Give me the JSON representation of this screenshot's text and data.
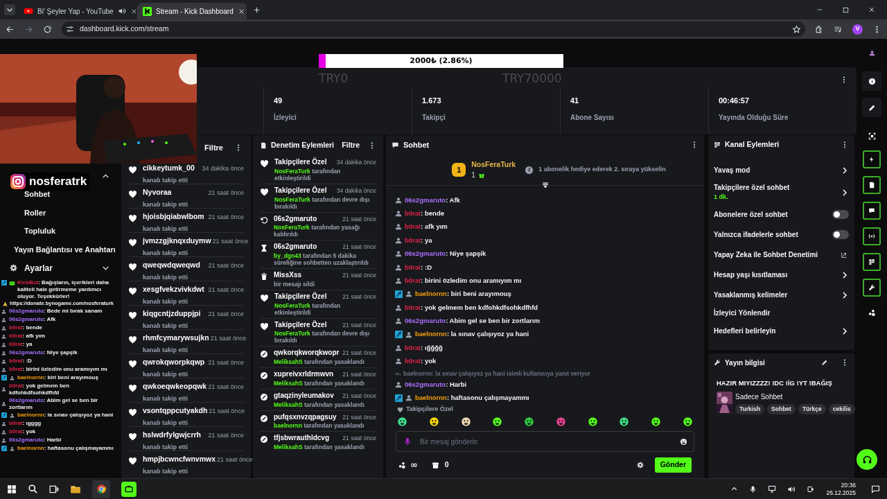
{
  "browser": {
    "tabs": [
      {
        "title": "Bi' Şeyler Yap - YouTube",
        "kind": "youtube",
        "selected": false,
        "audio": true
      },
      {
        "title": "Stream - Kick Dashboard",
        "kind": "kick",
        "selected": true,
        "audio": false
      }
    ],
    "url": "dashboard.kick.com/stream",
    "profile": "V"
  },
  "stream_overlay": {
    "instagram": "nosferatrk",
    "goal": {
      "label": "2000₺ (2.86%)",
      "level": 0.0286,
      "start": "TRY0",
      "end": "TRY70000"
    },
    "chat": [
      {
        "kind": "bot",
        "user": "KickBot",
        "color": "#e0204a",
        "text": ": Bağışların, içerikleri daha kaliteli hale getirmeme yardımcı oluyor. Teşekkürler!",
        "link": "https://donate.bynogame.com/nosferaturk",
        "moderator": true
      },
      {
        "kind": "message",
        "user": "06s2gmaruto",
        "color": "#a970ff",
        "text": ": Bede mi bırak sanam",
        "moderator": false
      },
      {
        "kind": "message",
        "user": "06s2gmaruto",
        "color": "#a970ff",
        "text": ": Afk",
        "moderator": false
      },
      {
        "kind": "message",
        "user": "b0rat",
        "color": "#e0204a",
        "text": ": bende",
        "moderator": false
      },
      {
        "kind": "message",
        "user": "b0rat",
        "color": "#e0204a",
        "text": ": afk yım",
        "moderator": false
      },
      {
        "kind": "message",
        "user": "b0rat",
        "color": "#e0204a",
        "text": ": ya",
        "moderator": false
      },
      {
        "kind": "message",
        "user": "06s2gmaruto",
        "color": "#a970ff",
        "text": ": Niye şapşik",
        "moderator": false
      },
      {
        "kind": "message",
        "user": "b0rat",
        "color": "#e0204a",
        "text": ": :D",
        "moderator": false
      },
      {
        "kind": "message",
        "user": "b0rat",
        "color": "#e0204a",
        "text": ": birini özledim onu aramıyım mı",
        "moderator": false
      },
      {
        "kind": "message",
        "user": "baelnornn",
        "color": "#f59e0b",
        "text": ": biri beni arayımouş",
        "moderator": true
      },
      {
        "kind": "message",
        "user": "b0rat",
        "color": "#e0204a",
        "text": ": yok gelmem ben kdfohkdfsohkdfhfd",
        "moderator": false
      },
      {
        "kind": "message",
        "user": "06s2gmaruto",
        "color": "#a970ff",
        "text": ": Abim gel se ben bir zortlarım",
        "moderator": false
      },
      {
        "kind": "message",
        "user": "baelnornn",
        "color": "#f59e0b",
        "text": ": la sınav çalışıyoz ya hani",
        "moderator": true
      },
      {
        "kind": "message",
        "user": "b0rat",
        "color": "#e0204a",
        "text": ": ıgggg",
        "moderator": false
      },
      {
        "kind": "message",
        "user": "b0rat",
        "color": "#e0204a",
        "text": ": yok",
        "moderator": false
      },
      {
        "kind": "message",
        "user": "06s2gmaruto",
        "color": "#a970ff",
        "text": ": Harbi",
        "moderator": false
      },
      {
        "kind": "message",
        "user": "baelnornn",
        "color": "#f59e0b",
        "text": ": haftasonu çalışmayammı",
        "moderator": true
      }
    ]
  },
  "sidebar": {
    "channel_expanded": true,
    "items": [
      {
        "label": "Sohbet",
        "kind": "sub"
      },
      {
        "label": "Roller",
        "kind": "sub"
      },
      {
        "label": "Topluluk",
        "kind": "sub"
      },
      {
        "label": "Yayın Bağlantısı ve Anahtarı",
        "kind": "link"
      }
    ],
    "settings": {
      "label": "Ayarlar",
      "expanded": false
    }
  },
  "stats": [
    {
      "value": "49",
      "label": "İzleyici"
    },
    {
      "value": "1.673",
      "label": "Takipçi"
    },
    {
      "value": "41",
      "label": "Abone Sayısı"
    },
    {
      "value": "00:46:57",
      "label": "Yayında Olduğu Süre"
    }
  ],
  "followers": {
    "filter": "Filtre",
    "items": [
      {
        "name": "cikkeytumk_00",
        "time": "34 dakika önce",
        "action": "kanalı takip etti"
      },
      {
        "name": "Nyvoraa",
        "time": "21 saat önce",
        "action": "kanalı takip etti"
      },
      {
        "name": "hjoisbjqiabwlbom",
        "time": "21 saat önce",
        "action": "kanalı takip etti"
      },
      {
        "name": "jvmzzgjknqxduymw",
        "time": "21 saat önce",
        "action": "kanalı takip etti"
      },
      {
        "name": "qweqwdqweqwd",
        "time": "21 saat önce",
        "action": "kanalı takip etti"
      },
      {
        "name": "xesgfvekzvivkdwt",
        "time": "21 saat önce",
        "action": "kanalı takip etti"
      },
      {
        "name": "kiqgcntjzduppjpi",
        "time": "21 saat önce",
        "action": "kanalı takip etti"
      },
      {
        "name": "rhmfcymarywsujkn",
        "time": "21 saat önce",
        "action": "kanalı takip etti"
      },
      {
        "name": "qwrokqworpkqwp",
        "time": "21 saat önce",
        "action": "kanalı takip etti"
      },
      {
        "name": "qwkoeqwkeopqwk",
        "time": "21 saat önce",
        "action": "kanalı takip etti"
      },
      {
        "name": "vsontqppcutyakdh",
        "time": "21 saat önce",
        "action": "kanalı takip etti"
      },
      {
        "name": "hslwdrfylgwjcrrh",
        "time": "21 saat önce",
        "action": "kanalı takip etti"
      },
      {
        "name": "hmpjbcwncfwnvmwx",
        "time": "21 saat önce",
        "action": "kanalı takip etti"
      }
    ]
  },
  "moderation": {
    "title": "Denetim Eylemleri",
    "filter": "Filtre",
    "items": [
      {
        "kind": "followers",
        "title": "Takipçilere Özel",
        "time": "34 dakika önce",
        "by": "NosFeraTurk",
        "text": "tarafından etkinleştirildi"
      },
      {
        "kind": "followers",
        "title": "Takipçilere Özel",
        "time": "34 dakika önce",
        "by": "NosFeraTurk",
        "text": "tarafından devre dışı bırakıldı"
      },
      {
        "kind": "unban",
        "title": "06s2gmaruto",
        "time": "21 saat önce",
        "by": "NosFeraTurk",
        "text": "tarafından yasağı kaldırıldı"
      },
      {
        "kind": "timeout",
        "title": "06s2gmaruto",
        "time": "21 saat önce",
        "by": "by_dgn43",
        "text": "tarafından 5 dakika süreliğine sohbetten uzaklaştırıldı"
      },
      {
        "kind": "delete",
        "title": "MissXss",
        "time": "21 saat önce",
        "text": "bir mesajı sildi"
      },
      {
        "kind": "followers",
        "title": "Takipçilere Özel",
        "time": "21 saat önce",
        "by": "NosFeraTurk",
        "text": "tarafından etkinleştirildi"
      },
      {
        "kind": "followers",
        "title": "Takipçilere Özel",
        "time": "21 saat önce",
        "by": "NosFeraTurk",
        "text": "tarafından devre dışı bırakıldı"
      },
      {
        "kind": "ban",
        "title": "qwkorqkworqkwopr",
        "time": "21 saat önce",
        "by": "MeliksahS",
        "text": "tarafından yasaklandı"
      },
      {
        "kind": "ban",
        "title": "xupreivxrldrmwvn",
        "time": "21 saat önce",
        "by": "MeliksahS",
        "text": "tarafından yasaklandı"
      },
      {
        "kind": "ban",
        "title": "gtaqzinyleumakov",
        "time": "21 saat önce",
        "by": "MeliksahS",
        "text": "tarafından yasaklandı"
      },
      {
        "kind": "ban",
        "title": "pufqsxnvzqpagsuy",
        "time": "21 saat önce",
        "by": "baelnornn",
        "text": "tarafından yasaklandı"
      },
      {
        "kind": "ban",
        "title": "tfjsbwrauthldcvg",
        "time": "21 saat önce",
        "by": "MeliksahS",
        "text": "tarafından yasaklandı"
      }
    ]
  },
  "chat": {
    "title": "Sohbet",
    "leader": {
      "rank": "1",
      "name": "NosFeraTurk",
      "count": "1",
      "next_rank": "2",
      "hint": "1 abonelik hediye ederek 2. sıraya yükselin"
    },
    "messages": [
      {
        "kind": "message",
        "user": "06s2gmaruto",
        "color": "#a970ff",
        "text": ": Afk",
        "moderator": false
      },
      {
        "kind": "message",
        "user": "b0rat",
        "color": "#e0204a",
        "text": ": bende",
        "moderator": false
      },
      {
        "kind": "message",
        "user": "b0rat",
        "color": "#e0204a",
        "text": ": afk yım",
        "moderator": false
      },
      {
        "kind": "message",
        "user": "b0rat",
        "color": "#e0204a",
        "text": ": ya",
        "moderator": false
      },
      {
        "kind": "message",
        "user": "06s2gmaruto",
        "color": "#a970ff",
        "text": ": Niye şapşik",
        "moderator": false
      },
      {
        "kind": "message",
        "user": "b0rat",
        "color": "#e0204a",
        "text": ": :D",
        "moderator": false
      },
      {
        "kind": "message",
        "user": "b0rat",
        "color": "#e0204a",
        "text": ": birini özledim onu aramıyım mı",
        "moderator": false
      },
      {
        "kind": "message",
        "user": "baelnornn",
        "color": "#f59e0b",
        "text": ": biri beni arayımouş",
        "moderator": true
      },
      {
        "kind": "message",
        "user": "b0rat",
        "color": "#e0204a",
        "text": ": yok gelmem ben kdfohkdfsohkdfhfd",
        "moderator": false
      },
      {
        "kind": "message",
        "user": "06s2gmaruto",
        "color": "#a970ff",
        "text": ": Abim gel se ben bir zortlarım",
        "moderator": false
      },
      {
        "kind": "message",
        "user": "baelnornn",
        "color": "#f59e0b",
        "text": ": la sınav çalışıyoz ya hani",
        "moderator": true
      },
      {
        "kind": "message",
        "user": "b0rat",
        "color": "#e0204a",
        "text": ": ığğğğ",
        "moderator": false
      },
      {
        "kind": "message",
        "user": "b0rat",
        "color": "#e0204a",
        "text": ": yok",
        "moderator": false
      },
      {
        "kind": "reply",
        "text": "baelnornn: la sınav çalışıyoz ya hani isimli kullanıcıya yanıt veriyor"
      },
      {
        "kind": "message",
        "user": "06s2gmaruto",
        "color": "#a970ff",
        "text": ": Harbi",
        "moderator": false
      },
      {
        "kind": "message",
        "user": "baelnornn",
        "color": "#f59e0b",
        "text": ": haftasonu çalışmayammı",
        "moderator": true
      }
    ],
    "mode_label": "Takipçilere Özel",
    "placeholder": "Bir mesaj gönderin",
    "points": "∞",
    "store_count": "0",
    "send": "Gönder"
  },
  "channel_actions": {
    "title": "Kanal Eylemleri",
    "items": [
      {
        "kind": "link",
        "label": "Yavaş mod"
      },
      {
        "kind": "link",
        "label": "Takipçilere özel sohbet",
        "sub": "1 dk."
      },
      {
        "kind": "toggle",
        "label": "Abonelere özel sohbet",
        "on": false
      },
      {
        "kind": "toggle",
        "label": "Yalnızca ifadelerle sohbet",
        "on": false
      },
      {
        "kind": "external",
        "label": "Yapay Zeka ile Sohbet Denetimi"
      },
      {
        "kind": "link",
        "label": "Hesap yaşı kısıtlaması"
      },
      {
        "kind": "link",
        "label": "Yasaklanmış kelimeler"
      },
      {
        "kind": "plain",
        "label": "İzleyici Yönlendir"
      },
      {
        "kind": "link",
        "label": "Hedefleri belirleyin"
      }
    ]
  },
  "stream_info": {
    "title": "Yayın bilgisi",
    "stream_title": "HAZIR MIYIZZZZ! !DC !İG !YT !BAĞIŞ",
    "category": "Sadece Sohbet",
    "tags": [
      "Turkish",
      "Sohbet",
      "Türkçe",
      "cekilis"
    ]
  },
  "taskbar": {
    "time": "20:36",
    "date": "26.12.2025"
  }
}
